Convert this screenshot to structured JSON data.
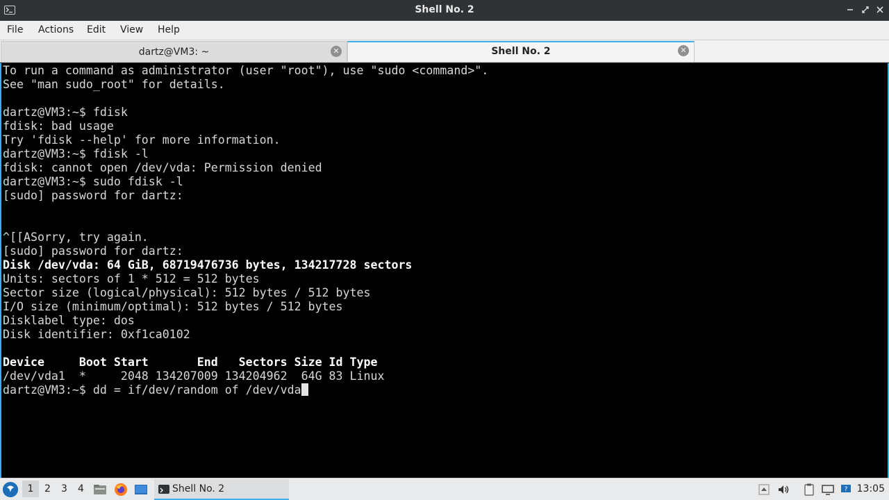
{
  "window": {
    "title": "Shell No. 2"
  },
  "menu": [
    "File",
    "Actions",
    "Edit",
    "View",
    "Help"
  ],
  "tabs": [
    {
      "label": "dartz@VM3: ~",
      "active": false
    },
    {
      "label": "Shell No. 2",
      "active": true
    }
  ],
  "terminal": {
    "lines": [
      {
        "text": "To run a command as administrator (user \"root\"), use \"sudo <command>\".",
        "bold": false
      },
      {
        "text": "See \"man sudo_root\" for details.",
        "bold": false
      },
      {
        "text": "",
        "bold": false
      },
      {
        "text": "dartz@VM3:~$ fdisk",
        "bold": false
      },
      {
        "text": "fdisk: bad usage",
        "bold": false
      },
      {
        "text": "Try 'fdisk --help' for more information.",
        "bold": false
      },
      {
        "text": "dartz@VM3:~$ fdisk -l",
        "bold": false
      },
      {
        "text": "fdisk: cannot open /dev/vda: Permission denied",
        "bold": false
      },
      {
        "text": "dartz@VM3:~$ sudo fdisk -l",
        "bold": false
      },
      {
        "text": "[sudo] password for dartz:",
        "bold": false
      },
      {
        "text": "",
        "bold": false
      },
      {
        "text": "",
        "bold": false
      },
      {
        "text": "^[[ASorry, try again.",
        "bold": false
      },
      {
        "text": "[sudo] password for dartz:",
        "bold": false
      },
      {
        "text": "Disk /dev/vda: 64 GiB, 68719476736 bytes, 134217728 sectors",
        "bold": true
      },
      {
        "text": "Units: sectors of 1 * 512 = 512 bytes",
        "bold": false
      },
      {
        "text": "Sector size (logical/physical): 512 bytes / 512 bytes",
        "bold": false
      },
      {
        "text": "I/O size (minimum/optimal): 512 bytes / 512 bytes",
        "bold": false
      },
      {
        "text": "Disklabel type: dos",
        "bold": false
      },
      {
        "text": "Disk identifier: 0xf1ca0102",
        "bold": false
      },
      {
        "text": "",
        "bold": false
      },
      {
        "text": "Device     Boot Start       End   Sectors Size Id Type",
        "bold": true
      },
      {
        "text": "/dev/vda1  *     2048 134207009 134204962  64G 83 Linux",
        "bold": false
      }
    ],
    "prompt_line": "dartz@VM3:~$ dd = if/dev/random of /dev/vda"
  },
  "taskbar": {
    "workspaces": [
      "1",
      "2",
      "3",
      "4"
    ],
    "task_label": "Shell No. 2",
    "clock": "13:05"
  },
  "colors": {
    "accent": "#3daee9",
    "terminal_bg": "#000000",
    "terminal_fg": "#d8d8d8"
  }
}
